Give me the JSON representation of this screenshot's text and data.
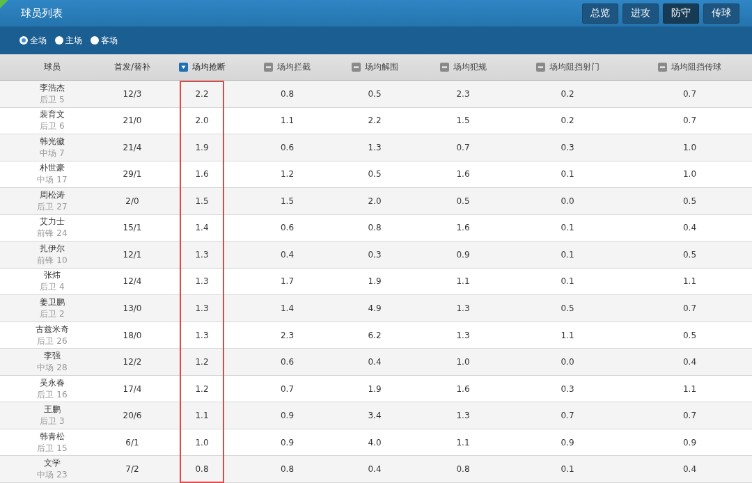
{
  "title": "球员列表",
  "view_tabs": [
    {
      "label": "总览",
      "selected": false
    },
    {
      "label": "进攻",
      "selected": false
    },
    {
      "label": "防守",
      "selected": true
    },
    {
      "label": "传球",
      "selected": false
    }
  ],
  "venue_filter": [
    {
      "label": "全场",
      "selected": true
    },
    {
      "label": "主场",
      "selected": false
    },
    {
      "label": "客场",
      "selected": false
    }
  ],
  "table": {
    "columns": [
      {
        "label": "球员",
        "kind": "plain"
      },
      {
        "label": "首发/替补",
        "kind": "plain"
      },
      {
        "label": "场均抢断",
        "kind": "sortable",
        "sorted": true,
        "highlighted": true
      },
      {
        "label": "场均拦截",
        "kind": "sortable",
        "sorted": false
      },
      {
        "label": "场均解围",
        "kind": "sortable",
        "sorted": false
      },
      {
        "label": "场均犯规",
        "kind": "sortable",
        "sorted": false
      },
      {
        "label": "场均阻挡射门",
        "kind": "sortable",
        "sorted": false
      },
      {
        "label": "场均阻挡传球",
        "kind": "sortable",
        "sorted": false
      }
    ],
    "rows": [
      {
        "cells": [
          {
            "name": "李浩杰",
            "position": "后卫 5"
          },
          "12/3",
          "2.2",
          "0.8",
          "0.5",
          "2.3",
          "0.2",
          "0.7"
        ]
      },
      {
        "cells": [
          {
            "name": "裴育文",
            "position": "后卫 6"
          },
          "21/0",
          "2.0",
          "1.1",
          "2.2",
          "1.5",
          "0.2",
          "0.7"
        ]
      },
      {
        "cells": [
          {
            "name": "韩光徽",
            "position": "中场 7"
          },
          "21/4",
          "1.9",
          "0.6",
          "1.3",
          "0.7",
          "0.3",
          "1.0"
        ]
      },
      {
        "cells": [
          {
            "name": "朴世豪",
            "position": "中场 17"
          },
          "29/1",
          "1.6",
          "1.2",
          "0.5",
          "1.6",
          "0.1",
          "1.0"
        ]
      },
      {
        "cells": [
          {
            "name": "周松涛",
            "position": "后卫 27"
          },
          "2/0",
          "1.5",
          "1.5",
          "2.0",
          "0.5",
          "0.0",
          "0.5"
        ]
      },
      {
        "cells": [
          {
            "name": "艾力士",
            "position": "前锋 24"
          },
          "15/1",
          "1.4",
          "0.6",
          "0.8",
          "1.6",
          "0.1",
          "0.4"
        ]
      },
      {
        "cells": [
          {
            "name": "扎伊尔",
            "position": "前锋 10"
          },
          "12/1",
          "1.3",
          "0.4",
          "0.3",
          "0.9",
          "0.1",
          "0.5"
        ]
      },
      {
        "cells": [
          {
            "name": "张炜",
            "position": "后卫 4"
          },
          "12/4",
          "1.3",
          "1.7",
          "1.9",
          "1.1",
          "0.1",
          "1.1"
        ]
      },
      {
        "cells": [
          {
            "name": "姜卫鹏",
            "position": "后卫 2"
          },
          "13/0",
          "1.3",
          "1.4",
          "4.9",
          "1.3",
          "0.5",
          "0.7"
        ]
      },
      {
        "cells": [
          {
            "name": "古兹米奇",
            "position": "后卫 26"
          },
          "18/0",
          "1.3",
          "2.3",
          "6.2",
          "1.3",
          "1.1",
          "0.5"
        ]
      },
      {
        "cells": [
          {
            "name": "李强",
            "position": "中场 28"
          },
          "12/2",
          "1.2",
          "0.6",
          "0.4",
          "1.0",
          "0.0",
          "0.4"
        ]
      },
      {
        "cells": [
          {
            "name": "吴永春",
            "position": "后卫 16"
          },
          "17/4",
          "1.2",
          "0.7",
          "1.9",
          "1.6",
          "0.3",
          "1.1"
        ]
      },
      {
        "cells": [
          {
            "name": "王鹏",
            "position": "后卫 3"
          },
          "20/6",
          "1.1",
          "0.9",
          "3.4",
          "1.3",
          "0.7",
          "0.7"
        ]
      },
      {
        "cells": [
          {
            "name": "韩青松",
            "position": "后卫 15"
          },
          "6/1",
          "1.0",
          "0.9",
          "4.0",
          "1.1",
          "0.9",
          "0.9"
        ]
      },
      {
        "cells": [
          {
            "name": "文学",
            "position": "中场 23"
          },
          "7/2",
          "0.8",
          "0.8",
          "0.4",
          "0.8",
          "0.1",
          "0.4"
        ]
      }
    ]
  }
}
